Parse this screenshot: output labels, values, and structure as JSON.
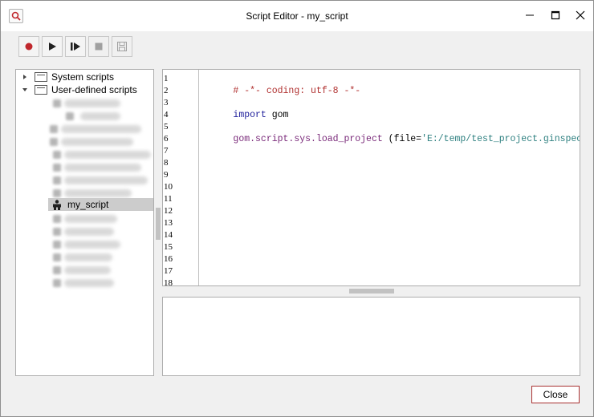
{
  "window": {
    "title": "Script Editor - my_script"
  },
  "toolbar": {
    "buttons": [
      {
        "name": "record",
        "icon": "record-icon",
        "enabled": true
      },
      {
        "name": "run",
        "icon": "play-icon",
        "enabled": true
      },
      {
        "name": "step",
        "icon": "step-icon",
        "enabled": true
      },
      {
        "name": "stop",
        "icon": "stop-icon",
        "enabled": false
      },
      {
        "name": "save",
        "icon": "save-icon",
        "enabled": false
      }
    ]
  },
  "tree": {
    "system_label": "System scripts",
    "user_label": "User-defined scripts",
    "selected_label": "my_script"
  },
  "editor": {
    "line_numbers": [
      "1",
      "2",
      "3",
      "4",
      "5",
      "6",
      "7",
      "8",
      "9",
      "10",
      "11",
      "12",
      "13",
      "14",
      "15",
      "16",
      "17",
      "18"
    ],
    "lines": {
      "l1_comment": "# -*- coding: utf-8 -*-",
      "l3_keyword": "import",
      "l3_rest": " gom",
      "l5_func": "gom.script.sys.load_project",
      "l5_open": " (file=",
      "l5_string": "'E:/temp/test_project.ginspect'",
      "l5_close": ")"
    }
  },
  "footer": {
    "close_label": "Close"
  },
  "colors": {
    "accent": "#a93232",
    "record": "#c0282d",
    "selection": "#cccccc"
  }
}
